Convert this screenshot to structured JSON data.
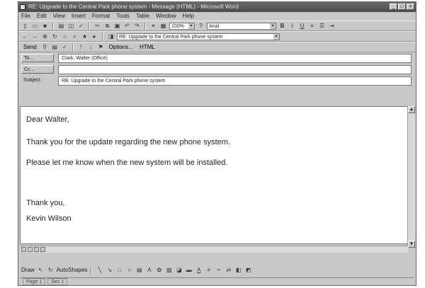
{
  "window": {
    "title": "RE: Upgrade to the Central Park phone system - Message (HTML) - Microsoft Word"
  },
  "menus": [
    "File",
    "Edit",
    "View",
    "Insert",
    "Format",
    "Tools",
    "Table",
    "Window",
    "Help"
  ],
  "formatting": {
    "zoom": "100%",
    "font": "Arial"
  },
  "message_toolbar": {
    "send_label": "Send",
    "options_label": "Options...",
    "format_label": "HTML"
  },
  "address_line": {
    "subject_preview": "RE: Upgrade to the Central Park phone system"
  },
  "fields": {
    "to_label": "To...",
    "to_value": "Clark, Walter (Office)",
    "cc_label": "Cc...",
    "cc_value": "",
    "subject_label": "Subject:",
    "subject_value": "RE: Upgrade to the Central Park phone system"
  },
  "body": {
    "greeting": "Dear Walter,",
    "line1": "Thank you for the update regarding the new phone system.",
    "line2": "Please let me know when the new system will be installed.",
    "closing": "Thank you,",
    "signature": "Kevin Wilson"
  },
  "drawing_toolbar": {
    "draw_label": "Draw",
    "autoshapes_label": "AutoShapes"
  },
  "status": {
    "page": "Page 1",
    "section": "Sec 1"
  }
}
